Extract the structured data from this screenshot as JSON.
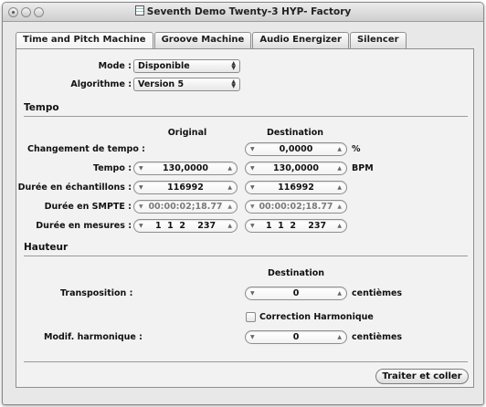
{
  "window": {
    "title": "Seventh Demo Twenty-3 HYP- Factory"
  },
  "tabs": [
    {
      "label": "Time and Pitch Machine",
      "active": true
    },
    {
      "label": "Groove Machine",
      "active": false
    },
    {
      "label": "Audio Energizer",
      "active": false
    },
    {
      "label": "Silencer",
      "active": false
    }
  ],
  "mode": {
    "label": "Mode :",
    "value": "Disponible"
  },
  "algorithm": {
    "label": "Algorithme :",
    "value": "Version 5"
  },
  "tempo": {
    "section_label": "Tempo",
    "col_original": "Original",
    "col_destination": "Destination",
    "rows": [
      {
        "label": "Changement de tempo :",
        "original": "",
        "destination": "0,0000",
        "unit": "%"
      },
      {
        "label": "Tempo :",
        "original": "130,0000",
        "destination": "130,0000",
        "unit": "BPM"
      },
      {
        "label": "Durée en échantillons :",
        "original": "116992",
        "destination": "116992",
        "unit": ""
      },
      {
        "label": "Durée en SMPTE :",
        "original": "00:00:02;18.77",
        "destination": "00:00:02;18.77",
        "unit": ""
      },
      {
        "label": "Durée en mesures :",
        "original": "1  1  2    237",
        "destination": "1  1  2    237",
        "unit": ""
      }
    ]
  },
  "pitch": {
    "section_label": "Hauteur",
    "col_destination": "Destination",
    "transposition": {
      "label": "Transposition :",
      "value": "0",
      "unit": "centièmes"
    },
    "correction": {
      "label": "Correction Harmonique",
      "checked": false
    },
    "harmonic": {
      "label": "Modif. harmonique :",
      "value": "0",
      "unit": "centièmes"
    }
  },
  "action_button": "Traiter et coller",
  "colors": {
    "window_bg": "#e8e8e8",
    "panel_bg": "#f2f2f2"
  }
}
